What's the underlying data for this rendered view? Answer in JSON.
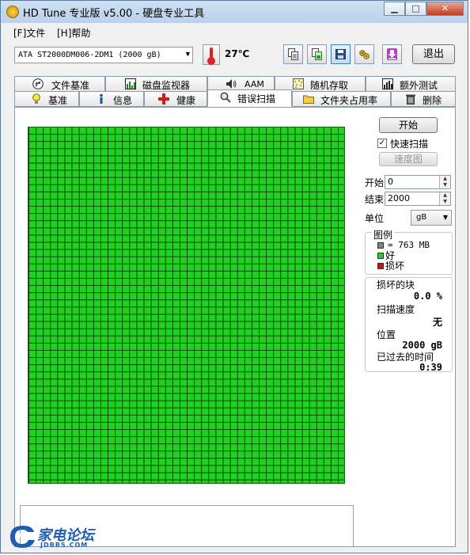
{
  "window": {
    "title": "HD Tune 专业版 v5.00 - 硬盘专业工具"
  },
  "menu": {
    "file": "[F]文件",
    "help": "[H]帮助"
  },
  "toolbar": {
    "drive": "ATA     ST2000DM006-2DM1  (2000 gB)",
    "temperature": "27℃",
    "exit_label": "退出"
  },
  "tabs_row1": [
    {
      "label": "文件基准",
      "icon": "file-benchmark-icon"
    },
    {
      "label": "磁盘监视器",
      "icon": "disk-monitor-icon"
    },
    {
      "label": "AAM",
      "icon": "speaker-icon"
    },
    {
      "label": "随机存取",
      "icon": "random-access-icon"
    },
    {
      "label": "额外测试",
      "icon": "extra-tests-icon"
    }
  ],
  "tabs_row2": [
    {
      "label": "基准",
      "icon": "lightbulb-icon"
    },
    {
      "label": "信息",
      "icon": "info-icon"
    },
    {
      "label": "健康",
      "icon": "health-cross-icon"
    },
    {
      "label": "错误扫描",
      "icon": "magnifier-icon",
      "active": true
    },
    {
      "label": "文件夹占用率",
      "icon": "folder-icon"
    },
    {
      "label": "删除",
      "icon": "trash-icon"
    }
  ],
  "scan": {
    "start_button": "开始",
    "quick_scan_label": "快速扫描",
    "quick_scan_checked": true,
    "speed_map_button": "速度图",
    "start_label": "开始",
    "start_value": "0",
    "end_label": "结束",
    "end_value": "2000",
    "unit_label": "单位",
    "unit_value": "gB"
  },
  "legend": {
    "title": "图例",
    "block_size": "= 763 MB",
    "good": "好",
    "bad": "损坏",
    "colors": {
      "block": "#808080",
      "good": "#22d022",
      "bad": "#d01010"
    }
  },
  "stats": {
    "damaged_label": "损坏的块",
    "damaged_value": "0.0 %",
    "speed_label": "扫描速度",
    "speed_value": "无",
    "position_label": "位置",
    "position_value": "2000 gB",
    "elapsed_label": "已过去的时间",
    "elapsed_value": "0:39"
  },
  "watermark": {
    "text": "家电论坛",
    "subtext": "JDBBS.COM"
  }
}
